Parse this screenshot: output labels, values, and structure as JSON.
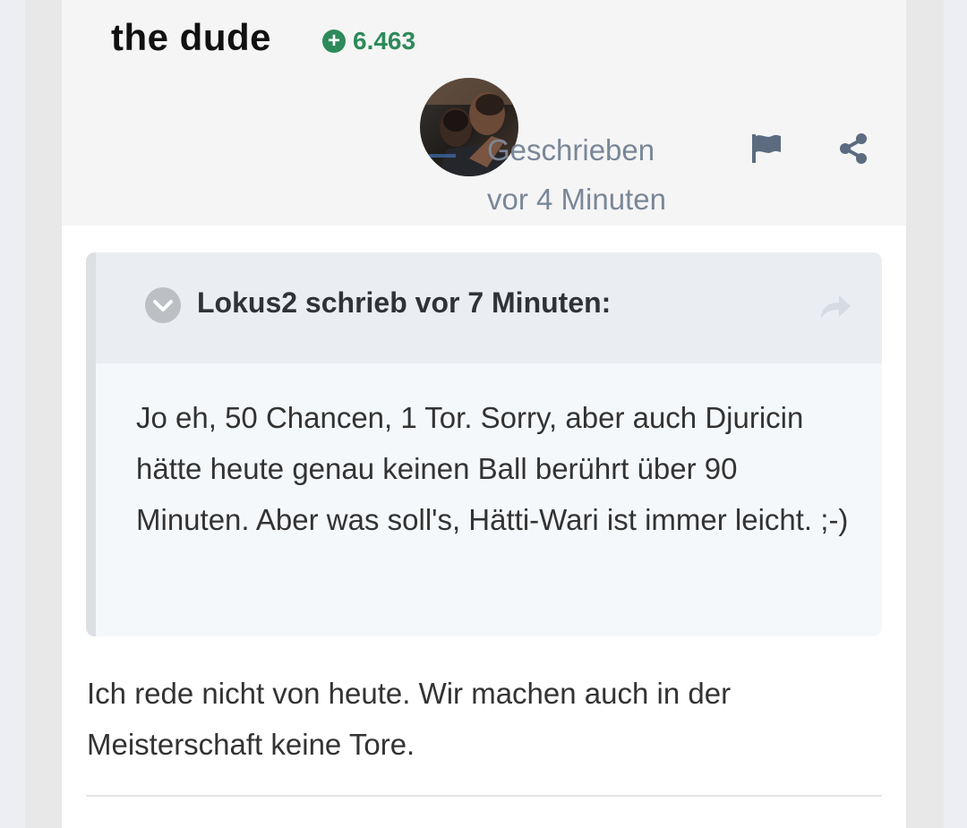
{
  "post": {
    "author": "the dude",
    "reputation": "6.463",
    "date_line1": "Geschrieben",
    "date_line2": "vor 4 Minuten",
    "quote": {
      "citation": "Lokus2 schrieb vor 7 Minuten:",
      "text": "Jo eh, 50 Chancen, 1 Tor. Sorry, aber auch Djuricin hätte heute genau keinen Ball berührt über 90 Minuten. Aber was soll's, Hätti-Wari ist immer leicht. ;-)"
    },
    "body": "Ich rede nicht von heute. Wir machen auch in der Meisterschaft keine Tore."
  },
  "icons": {
    "reputation": "plus-circle-icon",
    "flag": "flag-icon",
    "share": "share-icon",
    "quote_toggle": "chevron-down-icon",
    "quote_jump": "share-arrow-icon"
  },
  "colors": {
    "reputation_green": "#2d8a5a",
    "date_gray": "#7a8798",
    "icon_slate": "#5c6b80"
  }
}
